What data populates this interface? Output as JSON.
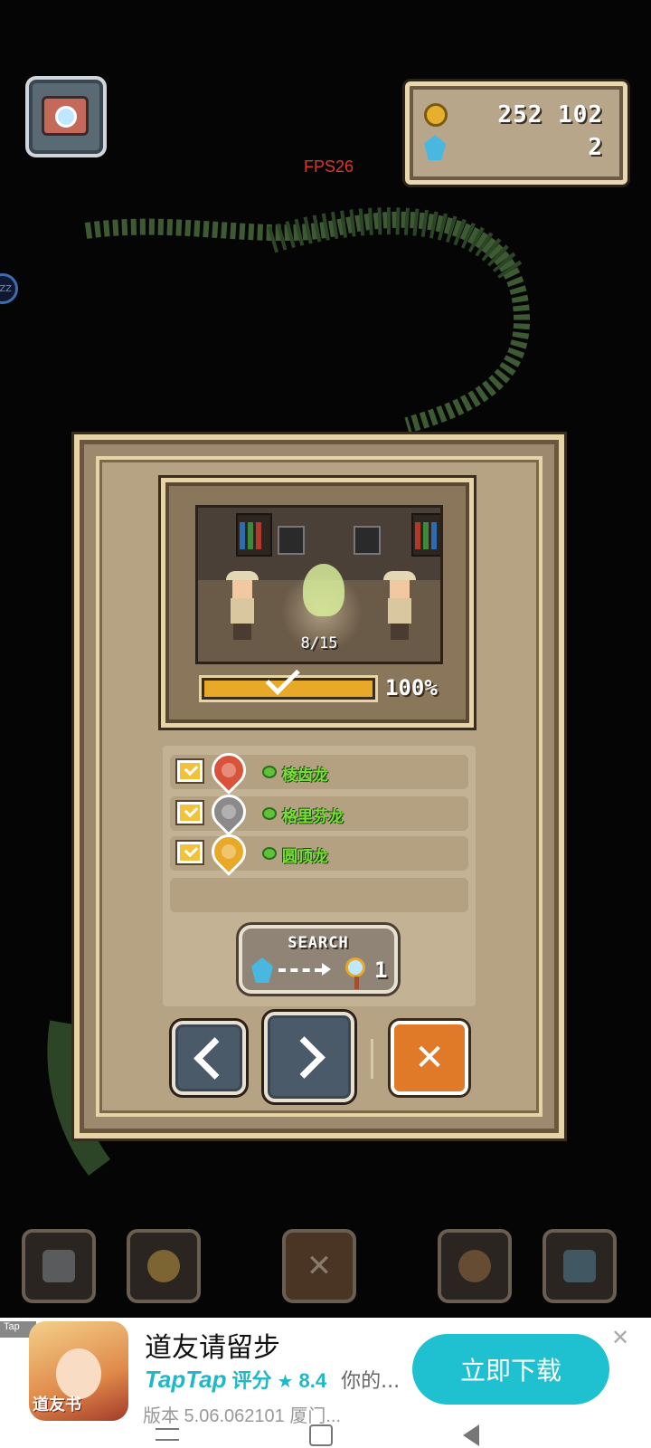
{
  "hud": {
    "coins": "252 102",
    "gems": "2",
    "fps": "FPS26",
    "side_bubble": "ZZ"
  },
  "dialog": {
    "scene_counter": "8/15",
    "progress_fraction": 1.0,
    "progress_label": "100%",
    "dinosaurs": [
      {
        "name": "棱齿龙",
        "checked": true,
        "pin_color": "#d9533a"
      },
      {
        "name": "格里芬龙",
        "checked": true,
        "pin_color": "#8a8a8a"
      },
      {
        "name": "圆顶龙",
        "checked": true,
        "pin_color": "#e8a828"
      }
    ],
    "search": {
      "label": "SEARCH",
      "count": "1"
    },
    "close_symbol": "✕"
  },
  "toolbar": {
    "items": [
      {
        "icon": "swap-icon"
      },
      {
        "icon": "lightbulb-icon"
      },
      {
        "icon": "close-icon",
        "symbol": "✕"
      },
      {
        "icon": "magnifier-tools-icon"
      },
      {
        "icon": "map-icon"
      }
    ]
  },
  "ad": {
    "tag": "Tap",
    "avatar_stamp": "道友书",
    "title": "道友请留步",
    "brand": "TapTap",
    "rating_label": "评分",
    "star": "★",
    "rating": "8.4",
    "desc": "你的...",
    "version": "版本 5.06.062101  厦门...",
    "cta": "立即下载",
    "close": "✕"
  },
  "colors": {
    "panel": "#b5a384",
    "frame": "#e6d4a6",
    "accent_orange": "#e07a28",
    "progress_fill": "#e8a828",
    "dino_name": "#7edc3a",
    "cta": "#1fc0cf"
  }
}
